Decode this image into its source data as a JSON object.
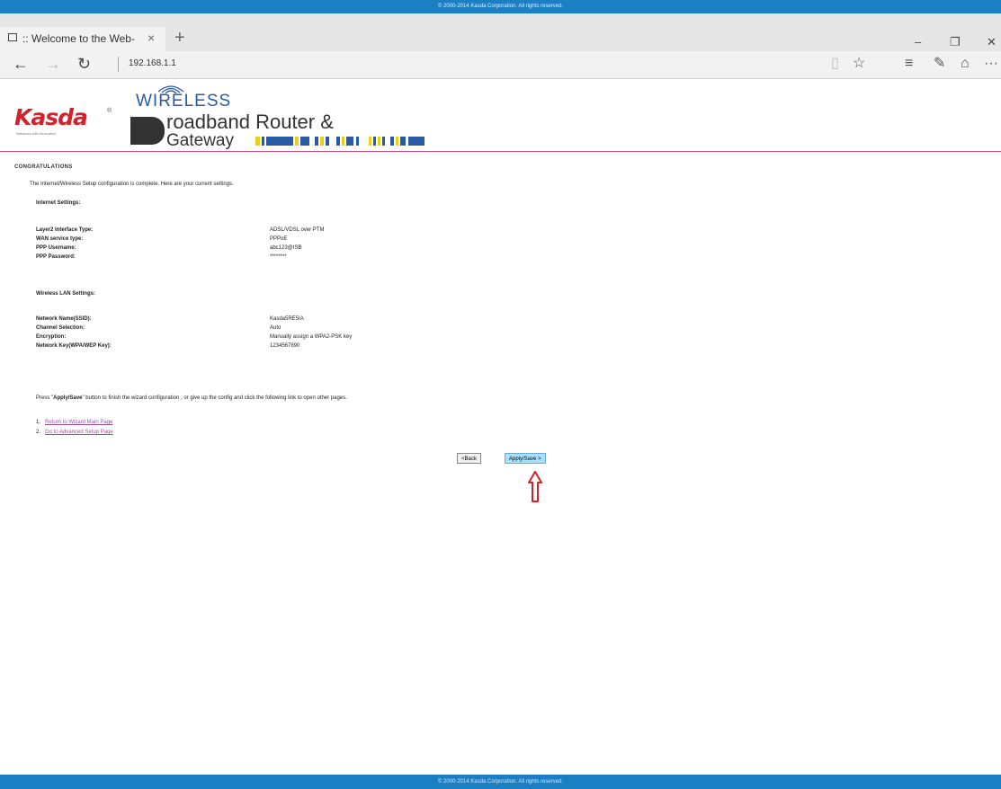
{
  "copyright_top": "© 2000-2014 Kasda Corporation. All rights reserved.",
  "copyright_bottom": "© 2000-2014 Kasda Corporation. All rights reserved.",
  "browser": {
    "tab_title": ":: Welcome to the Web-",
    "tab_close": "×",
    "new_tab": "+",
    "address": "192.168.1.1",
    "win_min": "‒",
    "win_restore": "❐",
    "win_close": "✕"
  },
  "icons": {
    "back": "←",
    "forward": "→",
    "refresh": "↻",
    "reading_view": "▯",
    "favorite": "☆",
    "hub": "≡",
    "web_note": "✎",
    "share": "⌂",
    "more": "···"
  },
  "header": {
    "brand": "Kasda",
    "brand_reg": "®",
    "brand_tagline": "Networks with Innovation",
    "wireless": "WIRELESS",
    "product_line1": "roadband Router &",
    "product_line2": "Gateway",
    "accent_color": "#2b5aa5",
    "brand_color": "#d2232a"
  },
  "page": {
    "title": "CONGRATULATIONS",
    "intro": "The Internet/Wireless Setup configuration is complete. Here are your current settings.",
    "internet_heading": "Internet Settings:",
    "internet_rows": [
      {
        "label": "Layer2 Interface Type:",
        "value": "ADSL/VDSL over PTM"
      },
      {
        "label": "WAN service type:",
        "value": "PPPoE"
      },
      {
        "label": "PPP Username:",
        "value": "abc123@ISB"
      },
      {
        "label": "PPP Password:",
        "value": "********"
      }
    ],
    "wireless_heading": "Wireless LAN Settings:",
    "wireless_rows": [
      {
        "label": "Network Name(SSID):",
        "value": "Kasda5RE5IA"
      },
      {
        "label": "Channel Selection:",
        "value": "Auto"
      },
      {
        "label": "Encryption:",
        "value": "Manually assign a WPA2-PSK key"
      },
      {
        "label": "Network Key(WPA/WEP Key):",
        "value": "1234567890"
      }
    ],
    "press_prefix": "Press \"",
    "press_bold": "Apply/Save",
    "press_suffix": "\" button to finish the wizard configuration , or give up the config and click the following link to open other pages.",
    "links": [
      {
        "num": "1.",
        "text": "Return to Wizard Main Page"
      },
      {
        "num": "2.",
        "text": "Go to Advanced Setup Page"
      }
    ],
    "back_button": "<Back",
    "apply_button": "Apply/Save >"
  }
}
